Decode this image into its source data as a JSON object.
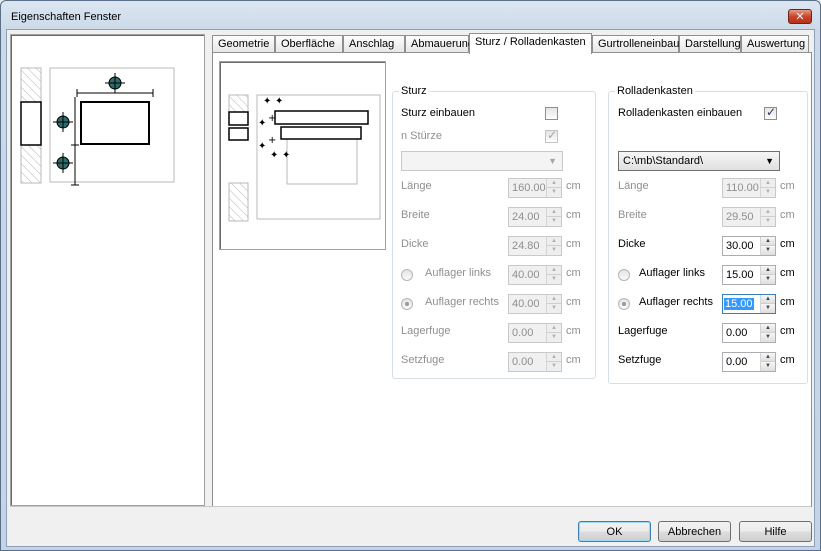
{
  "window": {
    "title": "Eigenschaften Fenster",
    "close_glyph": "✕"
  },
  "tabs": [
    {
      "label": "Geometrie",
      "active": false
    },
    {
      "label": "Oberfläche",
      "active": false
    },
    {
      "label": "Anschlag",
      "active": false
    },
    {
      "label": "Abmauerung",
      "active": false
    },
    {
      "label": "Sturz / Rolladenkasten",
      "active": true
    },
    {
      "label": "Gurtrolleneinbau",
      "active": false
    },
    {
      "label": "Darstellung",
      "active": false
    },
    {
      "label": "Auswertung",
      "active": false
    }
  ],
  "sturz": {
    "title": "Sturz",
    "einbauen_label": "Sturz einbauen",
    "einbauen_checked": false,
    "n_label": "n Stürze",
    "n_checked": true,
    "combo_value": "",
    "laenge_label": "Länge",
    "laenge_value": "160.00",
    "breite_label": "Breite",
    "breite_value": "24.00",
    "dicke_label": "Dicke",
    "dicke_value": "24.80",
    "auflager_links_label": "Auflager links",
    "auflager_links_value": "40.00",
    "auflager_rechts_label": "Auflager rechts",
    "auflager_rechts_value": "40.00",
    "lagerfuge_label": "Lagerfuge",
    "lagerfuge_value": "0.00",
    "setzfuge_label": "Setzfuge",
    "setzfuge_value": "0.00"
  },
  "rolladen": {
    "title": "Rolladenkasten",
    "einbauen_label": "Rolladenkasten einbauen",
    "einbauen_checked": true,
    "combo_value": "C:\\mb\\Standard\\",
    "laenge_label": "Länge",
    "laenge_value": "110.00",
    "breite_label": "Breite",
    "breite_value": "29.50",
    "dicke_label": "Dicke",
    "dicke_value": "30.00",
    "auflager_links_label": "Auflager links",
    "auflager_links_value": "15.00",
    "auflager_rechts_label": "Auflager rechts",
    "auflager_rechts_value": "15.00",
    "lagerfuge_label": "Lagerfuge",
    "lagerfuge_value": "0.00",
    "setzfuge_label": "Setzfuge",
    "setzfuge_value": "0.00"
  },
  "unit": "cm",
  "buttons": {
    "ok": "OK",
    "cancel": "Abbrechen",
    "help": "Hilfe"
  },
  "colors": {
    "accent": "#3399ff",
    "marker": "#2e6b6b"
  },
  "icons": {
    "close": "close-icon",
    "spin_up": "▲",
    "spin_down": "▼",
    "combo_arrow": "▼"
  }
}
